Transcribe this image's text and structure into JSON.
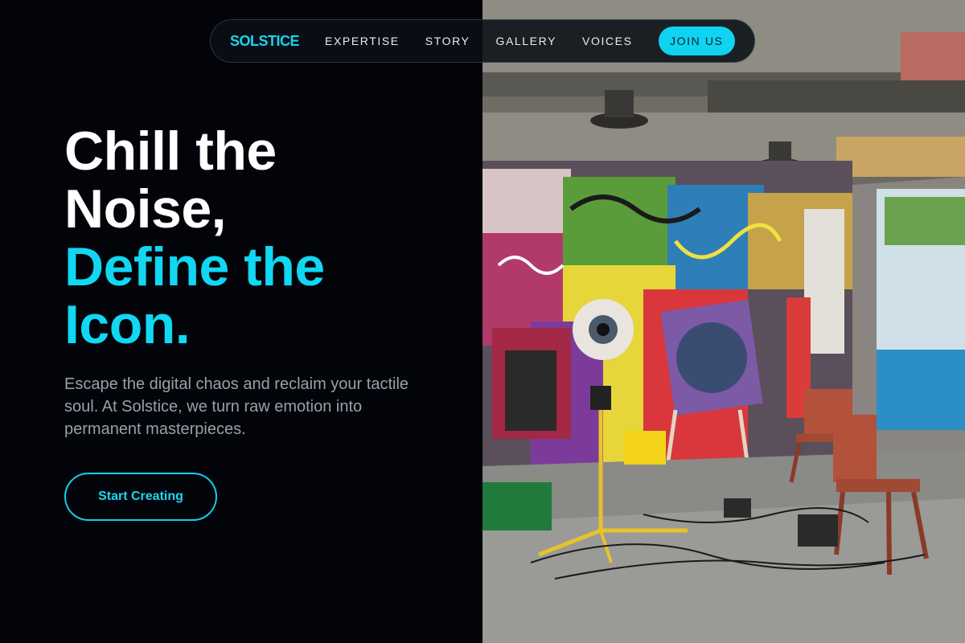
{
  "nav": {
    "logo": "SOLSTICE",
    "links": [
      "EXPERTISE",
      "STORY",
      "GALLERY",
      "VOICES"
    ],
    "cta": "JOIN US"
  },
  "hero": {
    "headline_line1": "Chill the",
    "headline_line2": "Noise,",
    "headline_line3": "Define the",
    "headline_line4": "Icon.",
    "subtext": "Escape the digital chaos and reclaim your tactile soul. At Solstice, we turn raw emotion into permanent masterpieces.",
    "cta": "Start Creating"
  },
  "image": {
    "subject": "graffiti-art-studio-photo"
  },
  "colors": {
    "accent": "#11d7f2",
    "background": "#020409",
    "muted_text": "#9aa0a8"
  }
}
